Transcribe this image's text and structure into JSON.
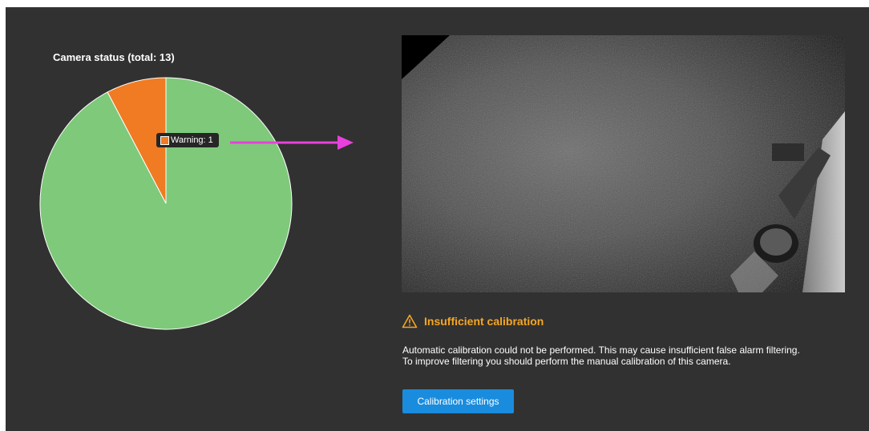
{
  "chart": {
    "title": "Camera status (total: 13)",
    "tooltip_label": "Warning: 1"
  },
  "chart_data": {
    "type": "pie",
    "title": "Camera status (total: 13)",
    "total": 13,
    "slices": [
      {
        "value": 12,
        "color": "#7ec97a"
      },
      {
        "label": "Warning",
        "value": 1,
        "color": "#f07b23"
      }
    ]
  },
  "warning": {
    "title": "Insufficient calibration",
    "line1": "Automatic calibration could not be performed. This may cause insufficient false alarm filtering.",
    "line2": "To improve filtering you should perform the manual calibration of this camera.",
    "color": "#f5a623"
  },
  "actions": {
    "calibration_label": "Calibration settings"
  },
  "colors": {
    "panel_bg": "#313131",
    "arrow": "#e940dd",
    "button": "#1a8cde"
  },
  "icons": {
    "warning": "warning-triangle-icon",
    "arrow": "arrow-right-icon"
  }
}
